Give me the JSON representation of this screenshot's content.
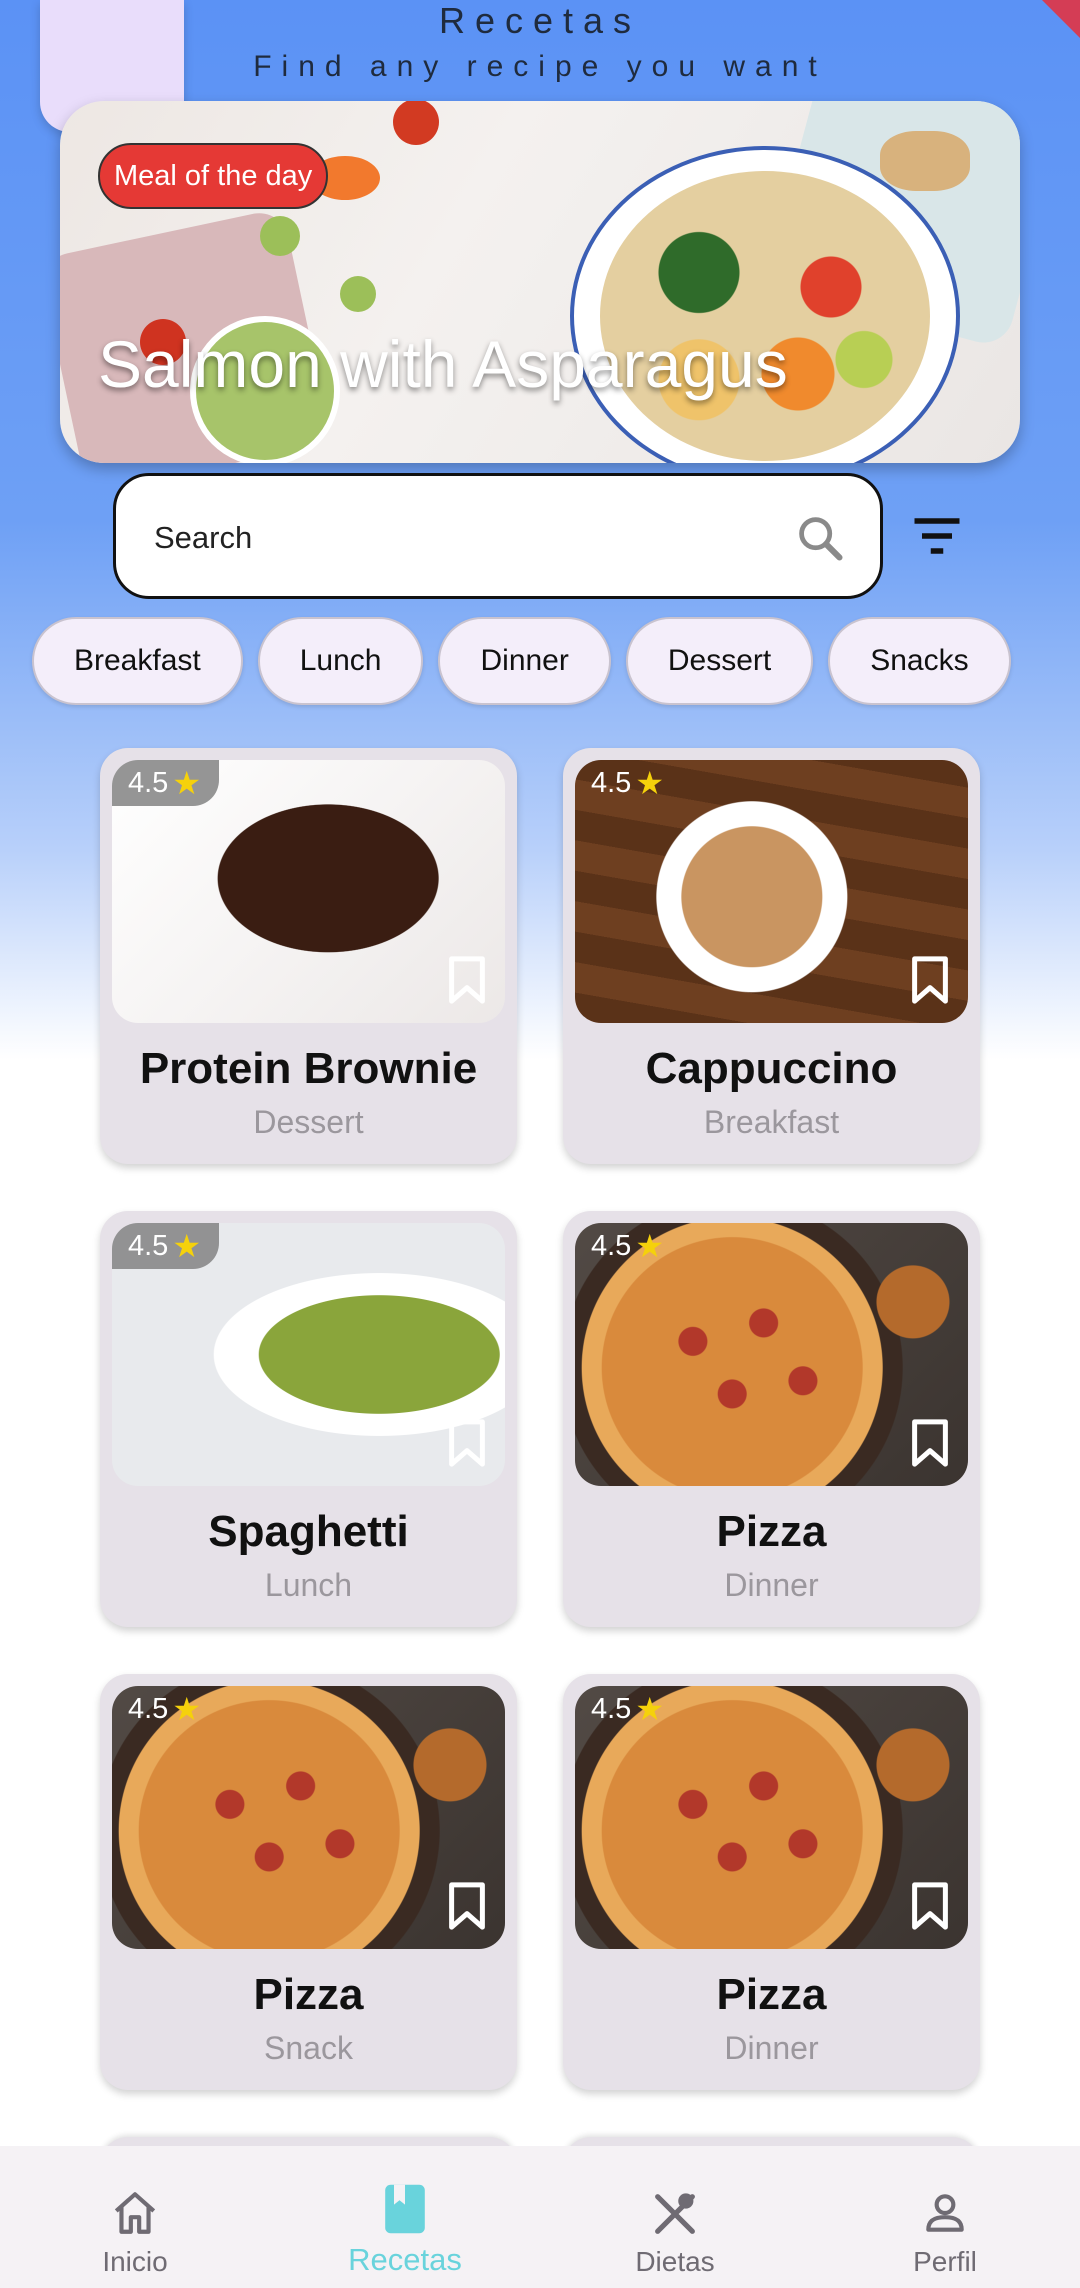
{
  "header": {
    "title": "Recetas",
    "subtitle": "Find any recipe you want"
  },
  "banner": {
    "badge": "Meal of the day",
    "title": "Salmon with Asparagus"
  },
  "search": {
    "placeholder": "Search"
  },
  "categories": [
    "Breakfast",
    "Lunch",
    "Dinner",
    "Dessert",
    "Snacks"
  ],
  "recipes": [
    {
      "rating": "4.5",
      "title": "Protein Brownie",
      "category": "Dessert",
      "icon": "brownie"
    },
    {
      "rating": "4.5",
      "title": "Cappuccino",
      "category": "Breakfast",
      "icon": "coffee"
    },
    {
      "rating": "4.5",
      "title": "Spaghetti",
      "category": "Lunch",
      "icon": "pasta"
    },
    {
      "rating": "4.5",
      "title": "Pizza",
      "category": "Dinner",
      "icon": "pizza"
    },
    {
      "rating": "4.5",
      "title": "Pizza",
      "category": "Snack",
      "icon": "pizza"
    },
    {
      "rating": "4.5",
      "title": "Pizza",
      "category": "Dinner",
      "icon": "pizza"
    }
  ],
  "nav": [
    {
      "label": "Inicio",
      "icon": "home-icon"
    },
    {
      "label": "Recetas",
      "icon": "book-icon",
      "active": true
    },
    {
      "label": "Dietas",
      "icon": "utensils-icon"
    },
    {
      "label": "Perfil",
      "icon": "person-icon"
    }
  ],
  "colors": {
    "accent": "#69d3dc",
    "badge": "#e53935",
    "star": "#f5d10b",
    "header_blue": "#5b92f5"
  }
}
